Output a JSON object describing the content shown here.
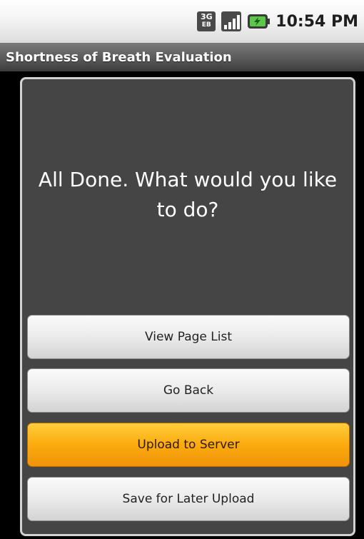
{
  "status_bar": {
    "network_type": "3G",
    "network_sub": "EB",
    "clock": "10:54 PM",
    "icons": [
      "network-3g-icon",
      "signal-strength-icon",
      "battery-charging-icon"
    ]
  },
  "app": {
    "title": "Shortness of Breath Evaluation"
  },
  "dialog": {
    "prompt": "All Done. What would you like to do?",
    "buttons": [
      {
        "label": "View Page List"
      },
      {
        "label": "Go Back"
      },
      {
        "label": "Upload to Server",
        "highlighted": true
      },
      {
        "label": "Save for Later Upload"
      }
    ]
  },
  "colors": {
    "panel_background": "#454545",
    "highlight_button": "#fbab0e",
    "default_button": "#ebebeb"
  }
}
